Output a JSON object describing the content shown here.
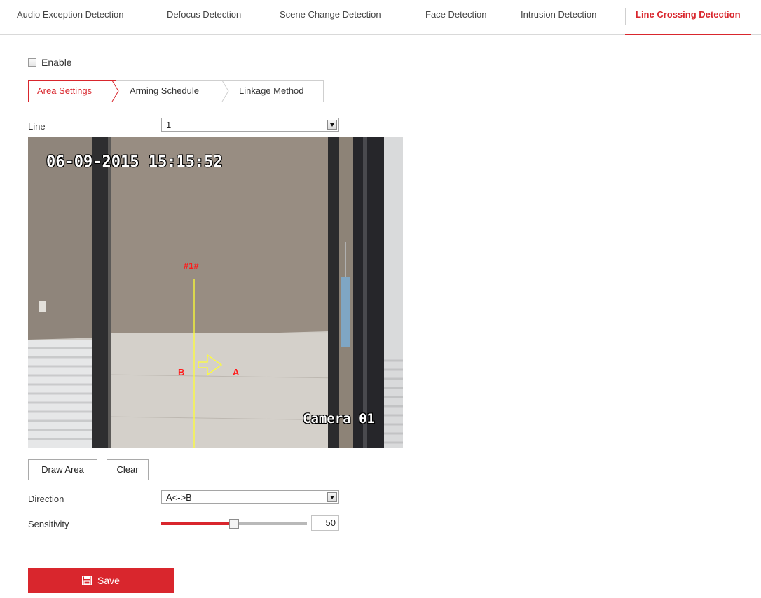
{
  "top_tabs": {
    "items": [
      {
        "label": "Audio Exception Detection"
      },
      {
        "label": "Defocus Detection"
      },
      {
        "label": "Scene Change Detection"
      },
      {
        "label": "Face Detection"
      },
      {
        "label": "Intrusion Detection"
      },
      {
        "label": "Line Crossing Detection"
      }
    ],
    "active_index": 5
  },
  "enable": {
    "label": "Enable",
    "checked": false
  },
  "sub_tabs": {
    "items": [
      {
        "label": "Area Settings"
      },
      {
        "label": "Arming Schedule"
      },
      {
        "label": "Linkage Method"
      }
    ],
    "active_index": 0
  },
  "line": {
    "label": "Line",
    "value": "1"
  },
  "video": {
    "timestamp": "06-09-2015 15:15:52",
    "camera_name": "Camera 01",
    "line_tag": "#1#",
    "side_a": "A",
    "side_b": "B"
  },
  "buttons": {
    "draw_area": "Draw Area",
    "clear": "Clear"
  },
  "direction": {
    "label": "Direction",
    "value": "A<->B"
  },
  "sensitivity": {
    "label": "Sensitivity",
    "value": "50",
    "fraction": 0.5
  },
  "save": {
    "label": "Save"
  },
  "colors": {
    "accent": "#d9262d",
    "line": "#ffff33",
    "label_red": "#ff1a1a"
  }
}
